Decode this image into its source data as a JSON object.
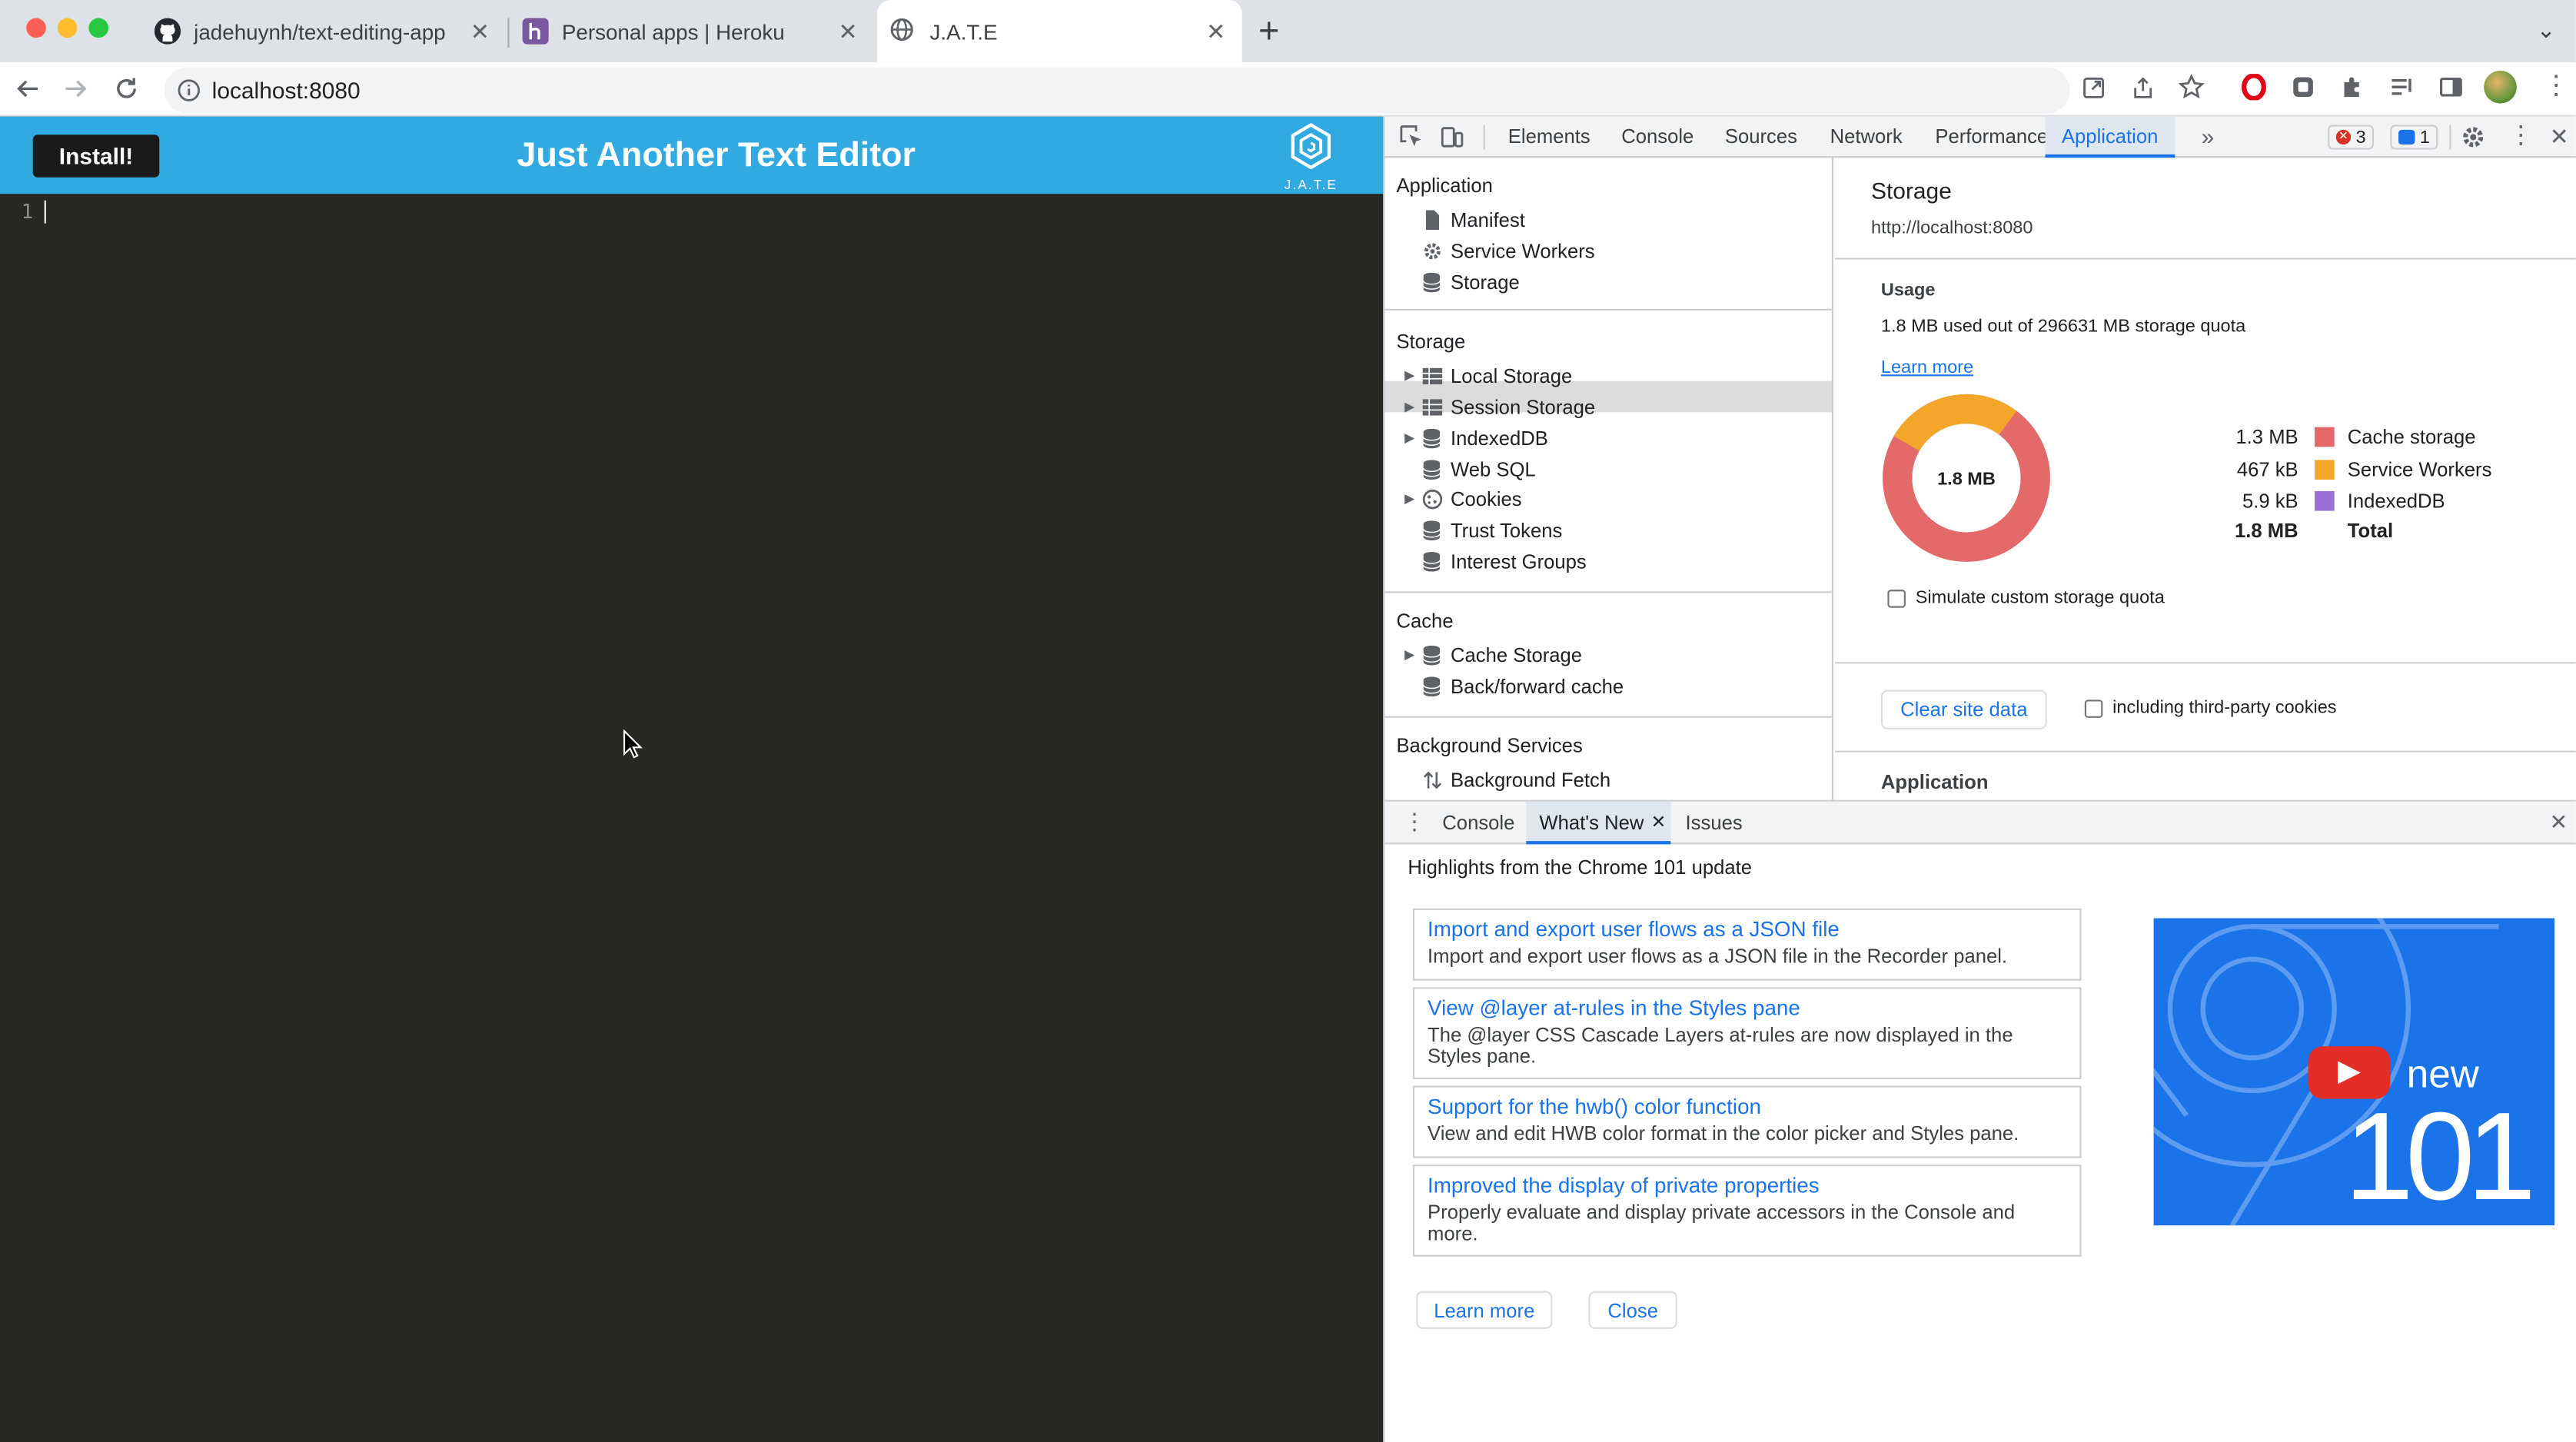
{
  "browser": {
    "tabs": [
      {
        "title": "jadehuynh/text-editing-app",
        "icon": "github-icon"
      },
      {
        "title": "Personal apps | Heroku",
        "icon": "heroku-icon"
      },
      {
        "title": "J.A.T.E",
        "icon": "globe-icon"
      }
    ],
    "url": "localhost:8080"
  },
  "app": {
    "install_label": "Install!",
    "title": "Just Another Text Editor",
    "logo_text": "J.A.T.E",
    "line_number": "1",
    "header_color": "#31a9e1",
    "editor_bg": "#272822"
  },
  "devtools": {
    "tabs": [
      "Elements",
      "Console",
      "Sources",
      "Network",
      "Performance",
      "Application"
    ],
    "error_count": "3",
    "message_count": "1",
    "sidebar": {
      "application_heading": "Application",
      "application_items": [
        "Manifest",
        "Service Workers",
        "Storage"
      ],
      "storage_heading": "Storage",
      "storage_items": [
        "Local Storage",
        "Session Storage",
        "IndexedDB",
        "Web SQL",
        "Cookies",
        "Trust Tokens",
        "Interest Groups"
      ],
      "cache_heading": "Cache",
      "cache_items": [
        "Cache Storage",
        "Back/forward cache"
      ],
      "bg_heading": "Background Services",
      "bg_items": [
        "Background Fetch"
      ]
    },
    "storage": {
      "title": "Storage",
      "origin": "http://localhost:8080",
      "usage_heading": "Usage",
      "usage_text": "1.8 MB used out of 296631 MB storage quota",
      "learn_more": "Learn more",
      "donut_center": "1.8 MB",
      "legend": [
        {
          "value": "1.3 MB",
          "label": "Cache storage",
          "color": "#e46a6a"
        },
        {
          "value": "467 kB",
          "label": "Service Workers",
          "color": "#f4a62a"
        },
        {
          "value": "5.9 kB",
          "label": "IndexedDB",
          "color": "#9b6fd8"
        }
      ],
      "total_value": "1.8 MB",
      "total_label": "Total",
      "simulate_label": "Simulate custom storage quota",
      "clear_button": "Clear site data",
      "third_party_label": "including third-party cookies",
      "application_heading": "Application"
    },
    "drawer": {
      "tabs": [
        "Console",
        "What's New",
        "Issues"
      ],
      "highlights": "Highlights from the Chrome 101 update",
      "items": [
        {
          "title": "Import and export user flows as a JSON file",
          "desc": "Import and export user flows as a JSON file in the Recorder panel."
        },
        {
          "title": "View @layer at-rules in the Styles pane",
          "desc": "The @layer CSS Cascade Layers at-rules are now displayed in the Styles pane."
        },
        {
          "title": "Support for the hwb() color function",
          "desc": "View and edit HWB color format in the color picker and Styles pane."
        },
        {
          "title": "Improved the display of private properties",
          "desc": "Properly evaluate and display private accessors in the Console and more."
        }
      ],
      "video_new": "new",
      "video_version": "101",
      "learn_more": "Learn more",
      "close": "Close"
    }
  }
}
